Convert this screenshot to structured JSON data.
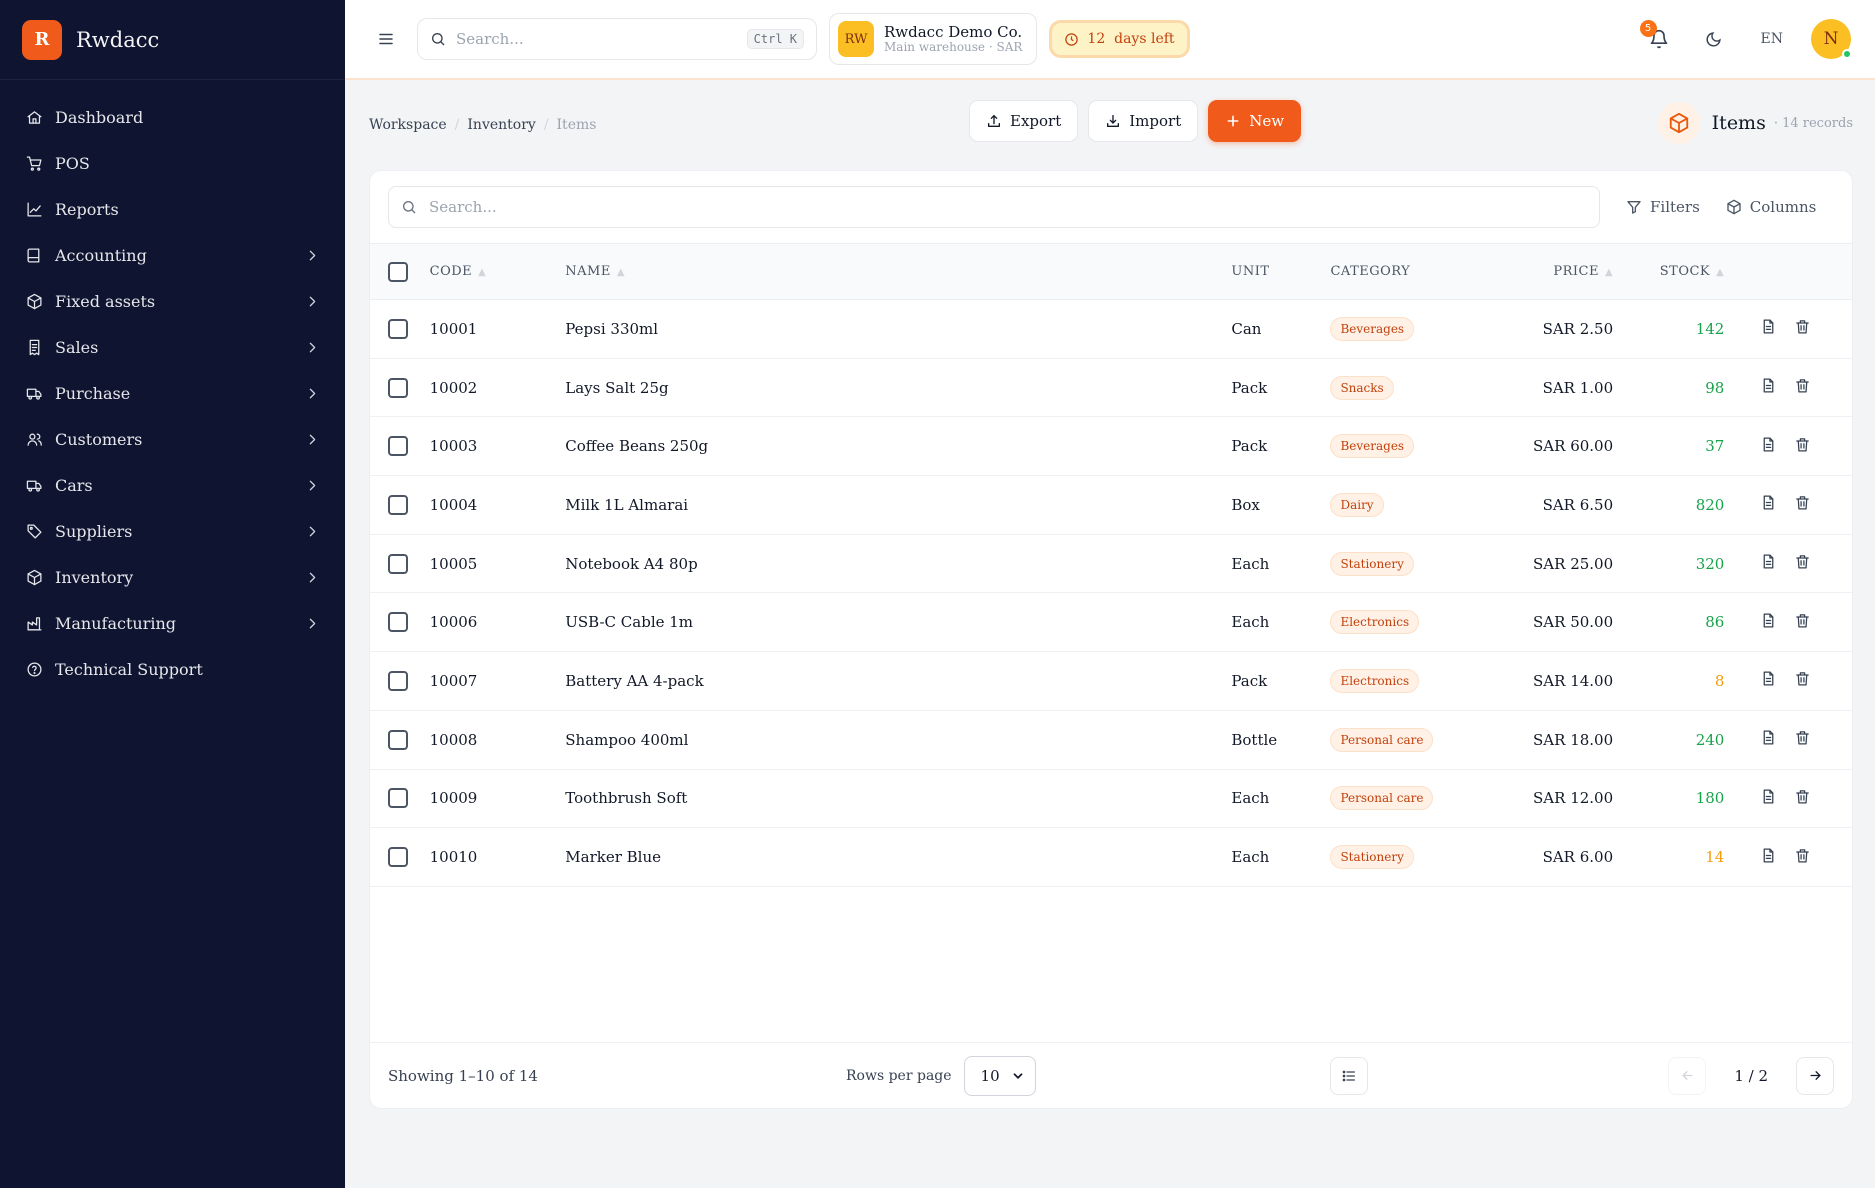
{
  "brand": {
    "logo_letter": "R",
    "name": "Rwdacc",
    "accent": "#f05a1a"
  },
  "sidebar": {
    "items": [
      {
        "label": "Dashboard",
        "icon": "home-icon",
        "has_children": false
      },
      {
        "label": "POS",
        "icon": "cart-icon",
        "has_children": false
      },
      {
        "label": "Reports",
        "icon": "chart-icon",
        "has_children": false
      },
      {
        "label": "Accounting",
        "icon": "book-icon",
        "has_children": true
      },
      {
        "label": "Fixed assets",
        "icon": "box-icon",
        "has_children": true
      },
      {
        "label": "Sales",
        "icon": "receipt-icon",
        "has_children": true
      },
      {
        "label": "Purchase",
        "icon": "truck-icon",
        "has_children": true
      },
      {
        "label": "Customers",
        "icon": "users-icon",
        "has_children": true
      },
      {
        "label": "Cars",
        "icon": "car-icon",
        "has_children": true
      },
      {
        "label": "Suppliers",
        "icon": "tag-icon",
        "has_children": true
      },
      {
        "label": "Inventory",
        "icon": "box-icon",
        "has_children": true
      },
      {
        "label": "Manufacturing",
        "icon": "factory-icon",
        "has_children": true
      },
      {
        "label": "Technical Support",
        "icon": "help-icon",
        "has_children": false
      }
    ]
  },
  "topbar": {
    "search_placeholder": "Search...",
    "search_shortcut": "Ctrl K",
    "company": {
      "initials": "RW",
      "name": "Rwdacc Demo Co.",
      "subtitle": "Main warehouse · SAR"
    },
    "trial_label": "12  days left",
    "notifications_count": "5",
    "language": "EN",
    "user_initial": "N"
  },
  "breadcrumb": {
    "items": [
      "Workspace",
      "Inventory"
    ],
    "current": "Items"
  },
  "actions": {
    "export_label": "Export",
    "import_label": "Import",
    "new_label": "New"
  },
  "page": {
    "title": "Items",
    "records": "· 14 records"
  },
  "table": {
    "search_placeholder": "Search...",
    "filters_label": "Filters",
    "columns_label": "Columns",
    "headers": {
      "code": "CODE",
      "name": "NAME",
      "unit": "UNIT",
      "category": "CATEGORY",
      "price": "PRICE",
      "stock": "STOCK"
    },
    "rows": [
      {
        "code": "10001",
        "name": "Pepsi 330ml",
        "unit": "Can",
        "category": "Beverages",
        "price": "SAR 2.50",
        "stock": "142",
        "stock_status": "ok"
      },
      {
        "code": "10002",
        "name": "Lays Salt 25g",
        "unit": "Pack",
        "category": "Snacks",
        "price": "SAR 1.00",
        "stock": "98",
        "stock_status": "ok"
      },
      {
        "code": "10003",
        "name": "Coffee Beans 250g",
        "unit": "Pack",
        "category": "Beverages",
        "price": "SAR 60.00",
        "stock": "37",
        "stock_status": "ok"
      },
      {
        "code": "10004",
        "name": "Milk 1L Almarai",
        "unit": "Box",
        "category": "Dairy",
        "price": "SAR 6.50",
        "stock": "820",
        "stock_status": "ok"
      },
      {
        "code": "10005",
        "name": "Notebook A4 80p",
        "unit": "Each",
        "category": "Stationery",
        "price": "SAR 25.00",
        "stock": "320",
        "stock_status": "ok"
      },
      {
        "code": "10006",
        "name": "USB-C Cable 1m",
        "unit": "Each",
        "category": "Electronics",
        "price": "SAR 50.00",
        "stock": "86",
        "stock_status": "ok"
      },
      {
        "code": "10007",
        "name": "Battery AA 4-pack",
        "unit": "Pack",
        "category": "Electronics",
        "price": "SAR 14.00",
        "stock": "8",
        "stock_status": "low"
      },
      {
        "code": "10008",
        "name": "Shampoo 400ml",
        "unit": "Bottle",
        "category": "Personal care",
        "price": "SAR 18.00",
        "stock": "240",
        "stock_status": "ok"
      },
      {
        "code": "10009",
        "name": "Toothbrush Soft",
        "unit": "Each",
        "category": "Personal care",
        "price": "SAR 12.00",
        "stock": "180",
        "stock_status": "ok"
      },
      {
        "code": "10010",
        "name": "Marker Blue",
        "unit": "Each",
        "category": "Stationery",
        "price": "SAR 6.00",
        "stock": "14",
        "stock_status": "low"
      }
    ]
  },
  "footer": {
    "showing": "Showing 1–10 of 14",
    "rows_per_page_label": "Rows per page",
    "rows_per_page_value": "10",
    "page_info": "1 / 2"
  },
  "colors": {
    "sidebar_bg": "#0f1530",
    "stock_ok": "#16a34a",
    "stock_low": "#f59e0b",
    "category_text": "#c2410c"
  }
}
